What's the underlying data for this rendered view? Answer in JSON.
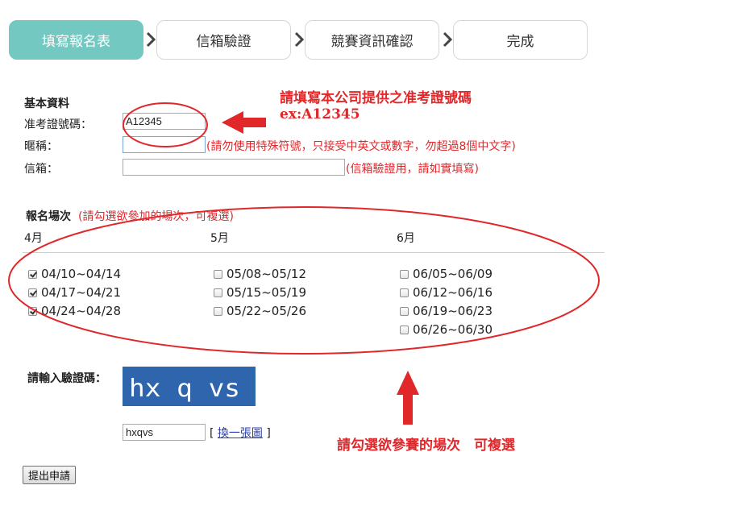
{
  "steps": [
    {
      "label": "填寫報名表",
      "active": true
    },
    {
      "label": "信箱驗證",
      "active": false
    },
    {
      "label": "競賽資訊確認",
      "active": false
    },
    {
      "label": "完成",
      "active": false
    }
  ],
  "basic": {
    "title": "基本資料",
    "id_label": "准考證號碼：",
    "id_value": "A12345",
    "nick_label": "暱稱：",
    "nick_value": "",
    "nick_hint": "(請勿使用特殊符號，只接受中英文或數字，勿超過8個中文字)",
    "email_label": "信箱：",
    "email_value": "",
    "email_hint": "(信箱驗證用，請如實填寫)"
  },
  "sessions": {
    "title": "報名場次",
    "hint": "(請勾選欲參加的場次，可複選)",
    "months": [
      {
        "label": "4月",
        "options": [
          {
            "label": "04/10~04/14",
            "checked": true
          },
          {
            "label": "04/17~04/21",
            "checked": true
          },
          {
            "label": "04/24~04/28",
            "checked": true
          }
        ]
      },
      {
        "label": "5月",
        "options": [
          {
            "label": "05/08~05/12",
            "checked": false
          },
          {
            "label": "05/15~05/19",
            "checked": false
          },
          {
            "label": "05/22~05/26",
            "checked": false
          }
        ]
      },
      {
        "label": "6月",
        "options": [
          {
            "label": "06/05~06/09",
            "checked": false
          },
          {
            "label": "06/12~06/16",
            "checked": false
          },
          {
            "label": "06/19~06/23",
            "checked": false
          },
          {
            "label": "06/26~06/30",
            "checked": false
          }
        ]
      }
    ]
  },
  "captcha": {
    "label": "請輸入驗證碼：",
    "image_text": "hx q vs",
    "value": "hxqvs",
    "refresh_open": "[",
    "refresh_label": "換一張圖",
    "refresh_close": "]"
  },
  "submit_label": "提出申請",
  "annotations": {
    "id_note_line1": "請填寫本公司提供之准考證號碼",
    "id_note_line2": "ex:A12345",
    "session_note": "請勾選欲參賽的場次　可複選"
  },
  "colors": {
    "accent": "#73c9c1",
    "annotation_red": "#e0282b",
    "captcha_bg": "#2f65ad"
  }
}
